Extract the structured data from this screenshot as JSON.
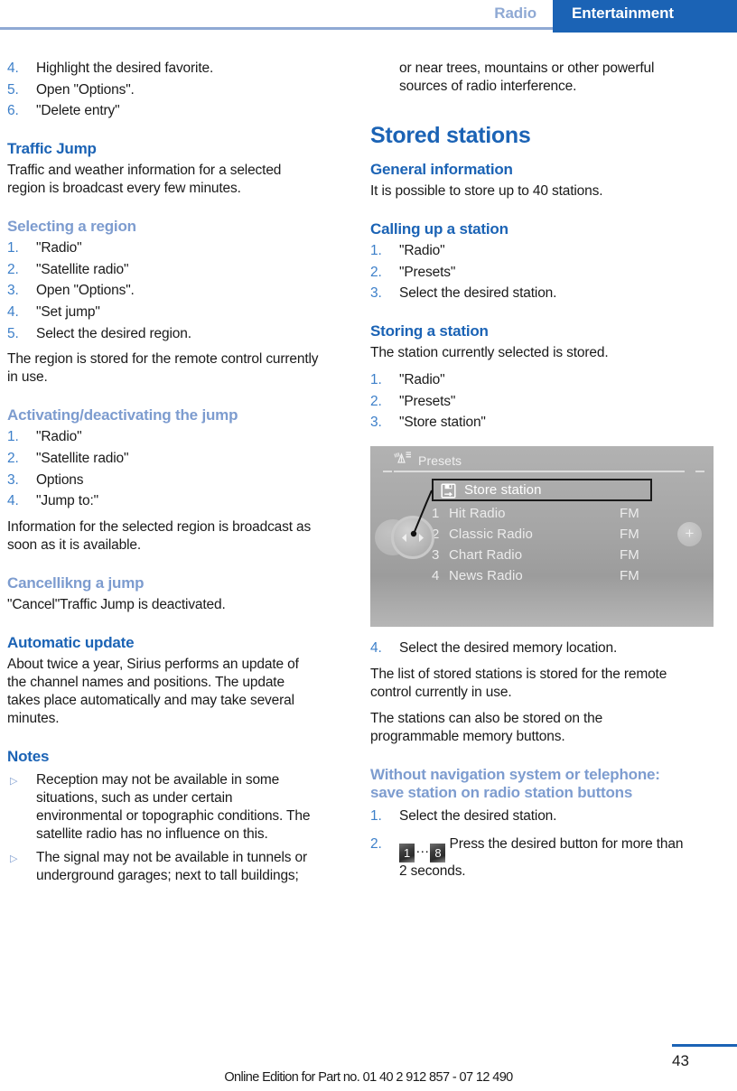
{
  "header": {
    "prev_tab": "Radio",
    "active_tab": "Entertainment",
    "accent_color": "#1b63b5",
    "muted_accent_color": "#8fa9d4"
  },
  "left_column": {
    "steps_top": [
      {
        "num": "4.",
        "text": "Highlight the desired favorite."
      },
      {
        "num": "5.",
        "text": "Open \"Options\"."
      },
      {
        "num": "6.",
        "text": "\"Delete entry\""
      }
    ],
    "traffic_jump": {
      "heading": "Traffic Jump",
      "intro": "Traffic and weather information for a selected region is broadcast every few minutes."
    },
    "selecting_region": {
      "heading": "Selecting a region",
      "steps": [
        {
          "num": "1.",
          "text": "\"Radio\""
        },
        {
          "num": "2.",
          "text": "\"Satellite radio\""
        },
        {
          "num": "3.",
          "text": "Open \"Options\"."
        },
        {
          "num": "4.",
          "text": "\"Set jump\""
        },
        {
          "num": "5.",
          "text": "Select the desired region."
        }
      ],
      "note": "The region is stored for the remote control currently in use."
    },
    "activating_jump": {
      "heading": "Activating/deactivating the jump",
      "steps": [
        {
          "num": "1.",
          "text": "\"Radio\""
        },
        {
          "num": "2.",
          "text": "\"Satellite radio\""
        },
        {
          "num": "3.",
          "text": "Options"
        },
        {
          "num": "4.",
          "text": "\"Jump to:\""
        }
      ],
      "note": "Information for the selected region is broadcast as soon as it is available."
    },
    "cancelling_jump": {
      "heading": "Cancellikng a jump",
      "text": "\"Cancel\"Traffic Jump is deactivated."
    },
    "automatic_update": {
      "heading": "Automatic update",
      "text": "About twice a year, Sirius performs an update of the channel names and positions. The update takes place automatically and may take several minutes."
    },
    "notes": {
      "heading": "Notes",
      "bullets": [
        "Reception may not be available in some situations, such as under certain environmental or topographic conditions. The satellite radio has no influence on this.",
        "The signal may not be available in tunnels or underground garages; next to tall buildings;"
      ]
    }
  },
  "right_column": {
    "continuation": "or near trees, mountains or other powerful sources of radio interference.",
    "stored_stations": {
      "heading": "Stored stations"
    },
    "general_information": {
      "heading": "General information",
      "text": "It is possible to store up to 40 stations."
    },
    "calling_up_station": {
      "heading": "Calling up a station",
      "steps": [
        {
          "num": "1.",
          "text": "\"Radio\""
        },
        {
          "num": "2.",
          "text": "\"Presets\""
        },
        {
          "num": "3.",
          "text": "Select the desired station."
        }
      ]
    },
    "storing_station": {
      "heading": "Storing a station",
      "intro": "The station currently selected is stored.",
      "steps": [
        {
          "num": "1.",
          "text": "\"Radio\""
        },
        {
          "num": "2.",
          "text": "\"Presets\""
        },
        {
          "num": "3.",
          "text": "\"Store station\""
        }
      ],
      "step_after_image": {
        "num": "4.",
        "text": "Select the desired memory location."
      },
      "note_1": "The list of stored stations is stored for the remote control currently in use.",
      "note_2": "The stations can also be stored on the programmable memory buttons."
    },
    "without_nav": {
      "heading": "Without navigation system or telephone: save station on radio station buttons",
      "step_1": {
        "num": "1.",
        "text": "Select the desired station."
      },
      "step_2": {
        "num": "2.",
        "key_first": "1",
        "key_ellipsis": "…",
        "key_last": "8",
        "text": "Press the desired button for more than 2 seconds."
      }
    }
  },
  "idrive_figure": {
    "header_icon": "satellite-radio-icon",
    "header_label": "Presets",
    "highlight_row": {
      "icon": "save-floppy-icon",
      "label": "Store station"
    },
    "presets": [
      {
        "num": "1",
        "name": "Hit Radio",
        "band": "FM"
      },
      {
        "num": "2",
        "name": "Classic Radio",
        "band": "FM"
      },
      {
        "num": "3",
        "name": "Chart Radio",
        "band": "FM"
      },
      {
        "num": "4",
        "name": "News Radio",
        "band": "FM"
      }
    ],
    "plus_button_label": "+"
  },
  "footer": {
    "note": "Online Edition for Part no. 01 40 2 912 857 - 07 12 490",
    "page_number": "43"
  }
}
